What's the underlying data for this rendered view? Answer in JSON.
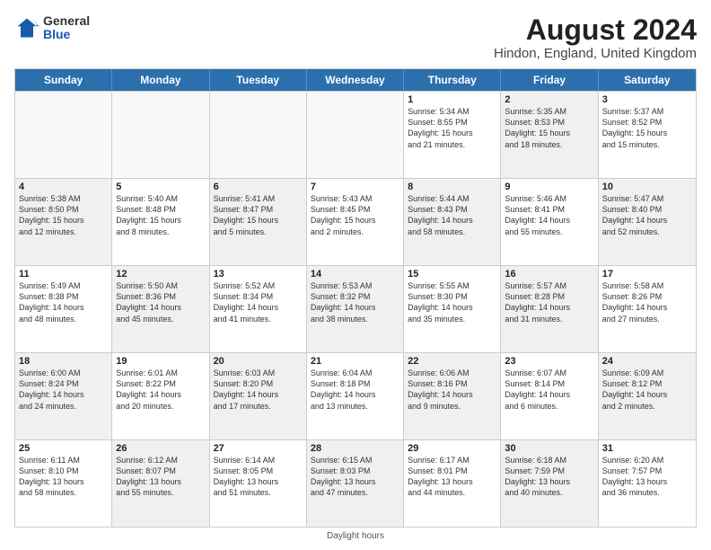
{
  "header": {
    "logo_general": "General",
    "logo_blue": "Blue",
    "month_year": "August 2024",
    "location": "Hindon, England, United Kingdom"
  },
  "days_of_week": [
    "Sunday",
    "Monday",
    "Tuesday",
    "Wednesday",
    "Thursday",
    "Friday",
    "Saturday"
  ],
  "weeks": [
    [
      {
        "day": "",
        "info": "",
        "shaded": false,
        "empty": true
      },
      {
        "day": "",
        "info": "",
        "shaded": false,
        "empty": true
      },
      {
        "day": "",
        "info": "",
        "shaded": false,
        "empty": true
      },
      {
        "day": "",
        "info": "",
        "shaded": false,
        "empty": true
      },
      {
        "day": "1",
        "info": "Sunrise: 5:34 AM\nSunset: 8:55 PM\nDaylight: 15 hours\nand 21 minutes.",
        "shaded": false,
        "empty": false
      },
      {
        "day": "2",
        "info": "Sunrise: 5:35 AM\nSunset: 8:53 PM\nDaylight: 15 hours\nand 18 minutes.",
        "shaded": true,
        "empty": false
      },
      {
        "day": "3",
        "info": "Sunrise: 5:37 AM\nSunset: 8:52 PM\nDaylight: 15 hours\nand 15 minutes.",
        "shaded": false,
        "empty": false
      }
    ],
    [
      {
        "day": "4",
        "info": "Sunrise: 5:38 AM\nSunset: 8:50 PM\nDaylight: 15 hours\nand 12 minutes.",
        "shaded": true,
        "empty": false
      },
      {
        "day": "5",
        "info": "Sunrise: 5:40 AM\nSunset: 8:48 PM\nDaylight: 15 hours\nand 8 minutes.",
        "shaded": false,
        "empty": false
      },
      {
        "day": "6",
        "info": "Sunrise: 5:41 AM\nSunset: 8:47 PM\nDaylight: 15 hours\nand 5 minutes.",
        "shaded": true,
        "empty": false
      },
      {
        "day": "7",
        "info": "Sunrise: 5:43 AM\nSunset: 8:45 PM\nDaylight: 15 hours\nand 2 minutes.",
        "shaded": false,
        "empty": false
      },
      {
        "day": "8",
        "info": "Sunrise: 5:44 AM\nSunset: 8:43 PM\nDaylight: 14 hours\nand 58 minutes.",
        "shaded": true,
        "empty": false
      },
      {
        "day": "9",
        "info": "Sunrise: 5:46 AM\nSunset: 8:41 PM\nDaylight: 14 hours\nand 55 minutes.",
        "shaded": false,
        "empty": false
      },
      {
        "day": "10",
        "info": "Sunrise: 5:47 AM\nSunset: 8:40 PM\nDaylight: 14 hours\nand 52 minutes.",
        "shaded": true,
        "empty": false
      }
    ],
    [
      {
        "day": "11",
        "info": "Sunrise: 5:49 AM\nSunset: 8:38 PM\nDaylight: 14 hours\nand 48 minutes.",
        "shaded": false,
        "empty": false
      },
      {
        "day": "12",
        "info": "Sunrise: 5:50 AM\nSunset: 8:36 PM\nDaylight: 14 hours\nand 45 minutes.",
        "shaded": true,
        "empty": false
      },
      {
        "day": "13",
        "info": "Sunrise: 5:52 AM\nSunset: 8:34 PM\nDaylight: 14 hours\nand 41 minutes.",
        "shaded": false,
        "empty": false
      },
      {
        "day": "14",
        "info": "Sunrise: 5:53 AM\nSunset: 8:32 PM\nDaylight: 14 hours\nand 38 minutes.",
        "shaded": true,
        "empty": false
      },
      {
        "day": "15",
        "info": "Sunrise: 5:55 AM\nSunset: 8:30 PM\nDaylight: 14 hours\nand 35 minutes.",
        "shaded": false,
        "empty": false
      },
      {
        "day": "16",
        "info": "Sunrise: 5:57 AM\nSunset: 8:28 PM\nDaylight: 14 hours\nand 31 minutes.",
        "shaded": true,
        "empty": false
      },
      {
        "day": "17",
        "info": "Sunrise: 5:58 AM\nSunset: 8:26 PM\nDaylight: 14 hours\nand 27 minutes.",
        "shaded": false,
        "empty": false
      }
    ],
    [
      {
        "day": "18",
        "info": "Sunrise: 6:00 AM\nSunset: 8:24 PM\nDaylight: 14 hours\nand 24 minutes.",
        "shaded": true,
        "empty": false
      },
      {
        "day": "19",
        "info": "Sunrise: 6:01 AM\nSunset: 8:22 PM\nDaylight: 14 hours\nand 20 minutes.",
        "shaded": false,
        "empty": false
      },
      {
        "day": "20",
        "info": "Sunrise: 6:03 AM\nSunset: 8:20 PM\nDaylight: 14 hours\nand 17 minutes.",
        "shaded": true,
        "empty": false
      },
      {
        "day": "21",
        "info": "Sunrise: 6:04 AM\nSunset: 8:18 PM\nDaylight: 14 hours\nand 13 minutes.",
        "shaded": false,
        "empty": false
      },
      {
        "day": "22",
        "info": "Sunrise: 6:06 AM\nSunset: 8:16 PM\nDaylight: 14 hours\nand 9 minutes.",
        "shaded": true,
        "empty": false
      },
      {
        "day": "23",
        "info": "Sunrise: 6:07 AM\nSunset: 8:14 PM\nDaylight: 14 hours\nand 6 minutes.",
        "shaded": false,
        "empty": false
      },
      {
        "day": "24",
        "info": "Sunrise: 6:09 AM\nSunset: 8:12 PM\nDaylight: 14 hours\nand 2 minutes.",
        "shaded": true,
        "empty": false
      }
    ],
    [
      {
        "day": "25",
        "info": "Sunrise: 6:11 AM\nSunset: 8:10 PM\nDaylight: 13 hours\nand 58 minutes.",
        "shaded": false,
        "empty": false
      },
      {
        "day": "26",
        "info": "Sunrise: 6:12 AM\nSunset: 8:07 PM\nDaylight: 13 hours\nand 55 minutes.",
        "shaded": true,
        "empty": false
      },
      {
        "day": "27",
        "info": "Sunrise: 6:14 AM\nSunset: 8:05 PM\nDaylight: 13 hours\nand 51 minutes.",
        "shaded": false,
        "empty": false
      },
      {
        "day": "28",
        "info": "Sunrise: 6:15 AM\nSunset: 8:03 PM\nDaylight: 13 hours\nand 47 minutes.",
        "shaded": true,
        "empty": false
      },
      {
        "day": "29",
        "info": "Sunrise: 6:17 AM\nSunset: 8:01 PM\nDaylight: 13 hours\nand 44 minutes.",
        "shaded": false,
        "empty": false
      },
      {
        "day": "30",
        "info": "Sunrise: 6:18 AM\nSunset: 7:59 PM\nDaylight: 13 hours\nand 40 minutes.",
        "shaded": true,
        "empty": false
      },
      {
        "day": "31",
        "info": "Sunrise: 6:20 AM\nSunset: 7:57 PM\nDaylight: 13 hours\nand 36 minutes.",
        "shaded": false,
        "empty": false
      }
    ]
  ],
  "footer": "Daylight hours"
}
